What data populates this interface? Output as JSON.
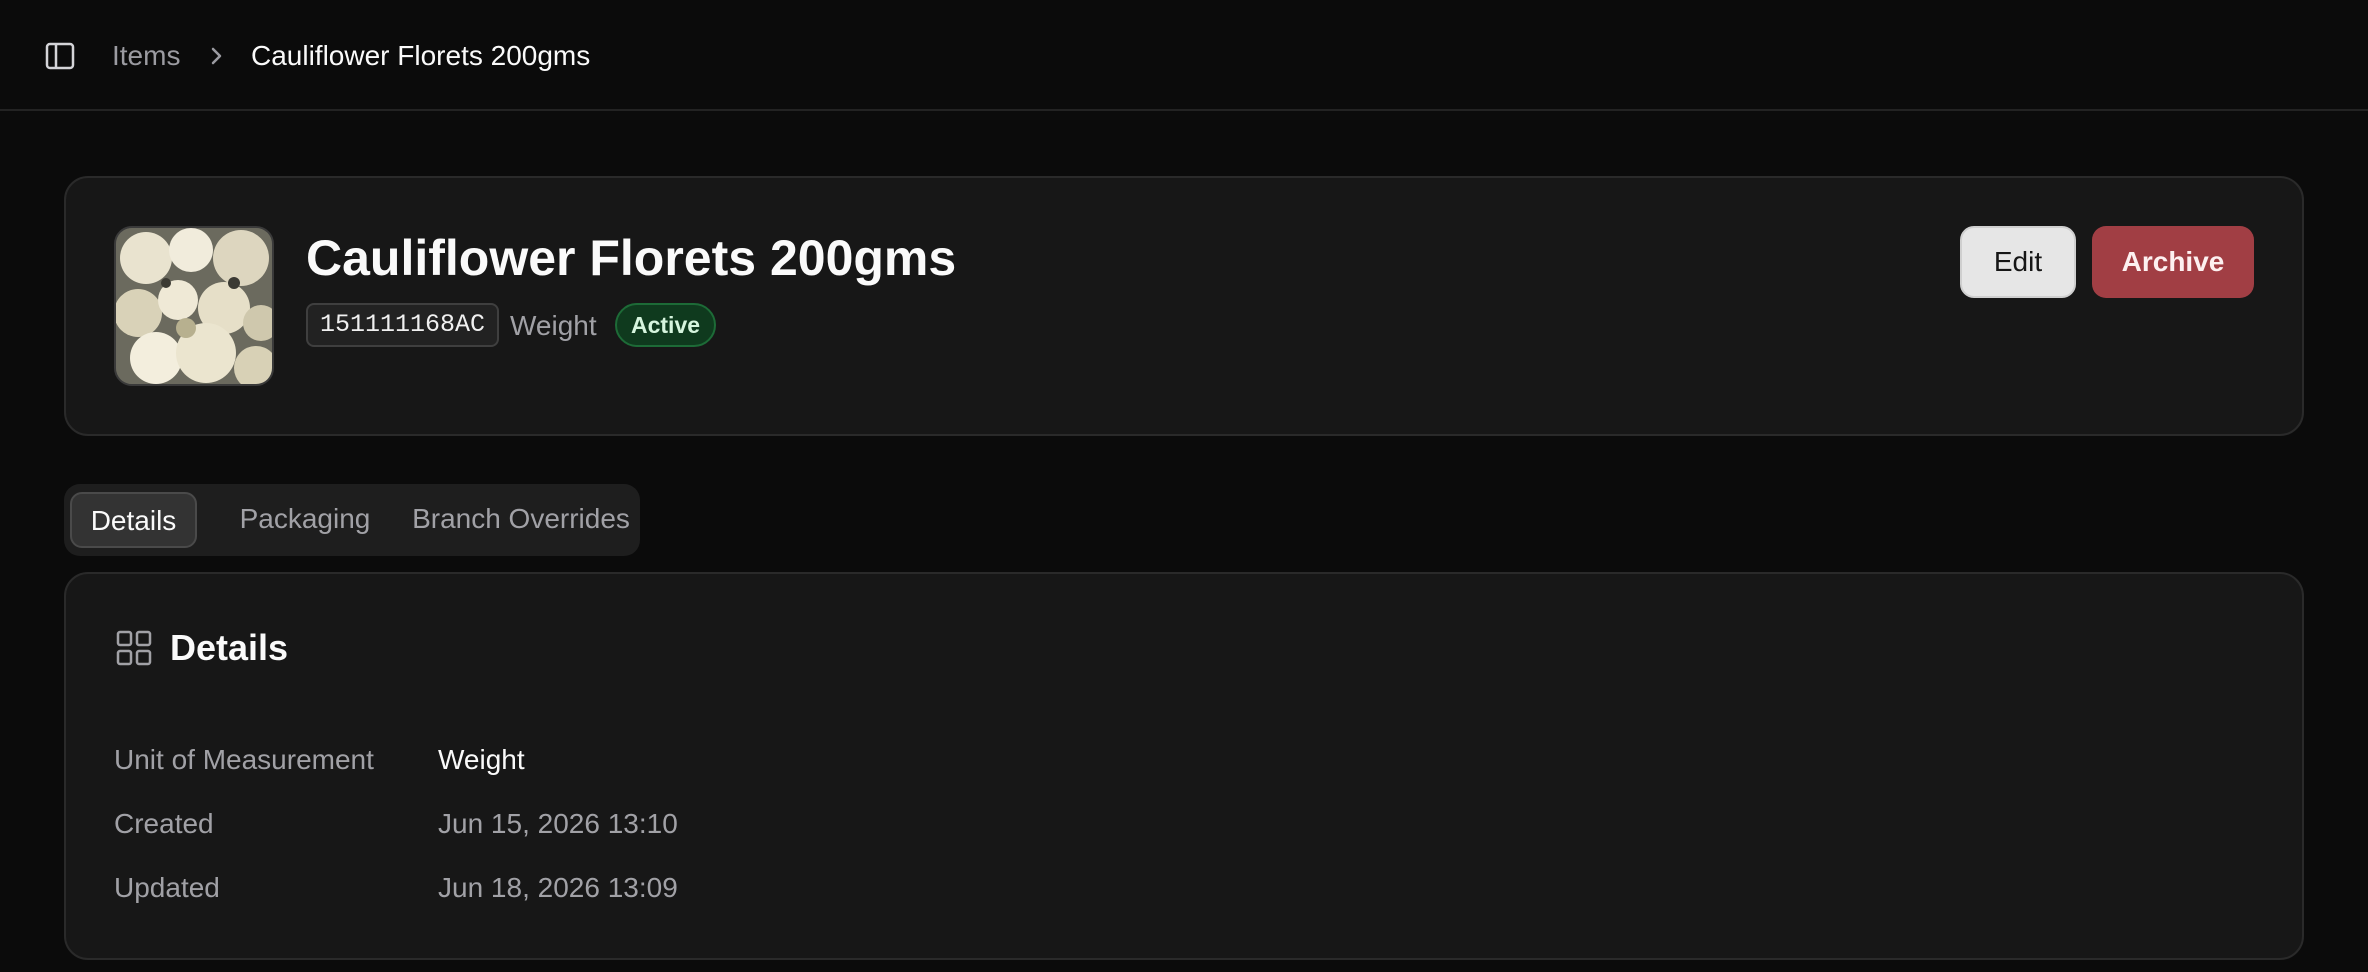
{
  "breadcrumb": {
    "parent": "Items",
    "current": "Cauliflower Florets 200gms"
  },
  "item": {
    "title": "Cauliflower Florets 200gms",
    "sku": "151111168AC",
    "uom": "Weight",
    "status": "Active",
    "image_icon": "cauliflower-photo"
  },
  "actions": {
    "edit_label": "Edit",
    "archive_label": "Archive"
  },
  "tabs": [
    {
      "label": "Details",
      "active": true
    },
    {
      "label": "Packaging",
      "active": false
    },
    {
      "label": "Branch Overrides",
      "active": false
    }
  ],
  "details": {
    "heading": "Details",
    "rows": [
      {
        "label": "Unit of Measurement",
        "value": "Weight"
      },
      {
        "label": "Created",
        "value": "Jun 15, 2026 13:10"
      },
      {
        "label": "Updated",
        "value": "Jun 18, 2026 13:09"
      }
    ]
  },
  "colors": {
    "background": "#0b0b0b",
    "card": "#171717",
    "archive": "#a13e44",
    "status_active": "#0f3a1e"
  }
}
